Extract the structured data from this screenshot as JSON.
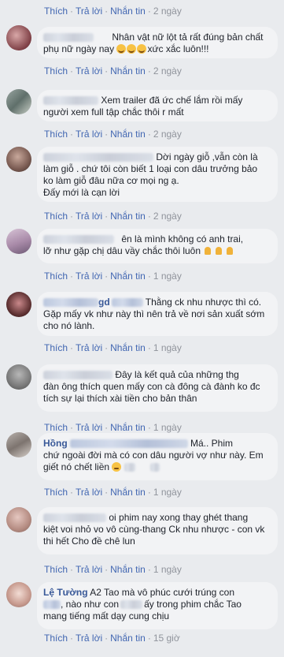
{
  "actions": {
    "like": "Thích",
    "reply": "Trả lời",
    "message": "Nhắn tin",
    "sep": "·"
  },
  "comments": [
    {
      "time": "2 ngày",
      "text": ""
    },
    {
      "text": "Nhân vật nữ lột tả rất đúng bản chất phụ nữ ngày nay",
      "text_tail": "xức xắc luôn!!!",
      "time": "2 ngày"
    },
    {
      "text": "Xem trailer đã ức chế lắm rồi mấy người xem full tập chắc thôi r mất",
      "time": "2 ngày"
    },
    {
      "text_line1": "Dời ngày giỗ ,vẫn còn là",
      "text_rest": "làm giỗ . chứ tôi còn biết 1 loại con dâu trưởng bảo ko làm giỗ đâu nữa cơ mọi ng ạ.",
      "text_line3": "Đấy mới là cạn lời",
      "time": "2 ngày"
    },
    {
      "text_line1": "ên là mình không có anh trai,",
      "text_rest": "lỡ như gặp chị dâu vầy chắc thôi luôn",
      "time": "1 ngày"
    },
    {
      "author_fragment": "gd",
      "text_line1": "Thằng ck nhu nhược thì có.",
      "text_rest": "Gặp mấy vk như này thì nên trả về nơi sản xuất sớm cho nó lành.",
      "time": "1 ngày"
    },
    {
      "text_line1": "Đây là kết quả của những thg",
      "text_rest": "đàn ông thích quen mấy con cà đông cà đành ko đc tích sự lại thích xài tiền cho bản thân",
      "time": "1 ngày"
    },
    {
      "author_fragment": "Hồng",
      "text_line1": "Má.. Phim",
      "text_rest": "chứ ngoài đời mà có con dâu người vợ như này. Em giết nó chết liền",
      "time": "1 ngày"
    },
    {
      "text_line1": "oi phim nay xong thay ghét thang",
      "text_rest": "kiệt voi nhỏ vo vô cùng-thang Ck nhu nhược - con vk thi hết Cho đề chê lun",
      "time": "1 ngày"
    },
    {
      "author": "Lệ Tường",
      "text_line1": "A2 Tao mà vô phúc cưới trúng con",
      "text_mid": ", nào như con",
      "text_mid2": "ấy trong phim chắc Tao",
      "text_rest": "mang tiếng mất dạy cung chịu",
      "time": "15 giờ"
    }
  ],
  "colors": {
    "link": "#4267b2",
    "author": "#385898",
    "bubble": "#f2f3f5",
    "background": "#e9ebee"
  }
}
